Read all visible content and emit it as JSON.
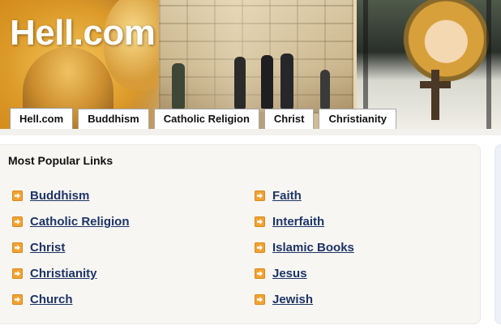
{
  "site": {
    "title": "Hell.com"
  },
  "tabs": [
    {
      "label": "Hell.com",
      "active": true
    },
    {
      "label": "Buddhism",
      "active": false
    },
    {
      "label": "Catholic Religion",
      "active": false
    },
    {
      "label": "Christ",
      "active": false
    },
    {
      "label": "Christianity",
      "active": false
    }
  ],
  "popular": {
    "title": "Most Popular Links",
    "bullet_icon": "arrow-right-icon",
    "bullet_color": "#f2a233",
    "link_color": "#1e3466",
    "left_links": [
      "Buddhism",
      "Catholic Religion",
      "Christ",
      "Christianity",
      "Church"
    ],
    "right_links": [
      "Faith",
      "Interfaith",
      "Islamic Books",
      "Jesus",
      "Jewish"
    ]
  }
}
